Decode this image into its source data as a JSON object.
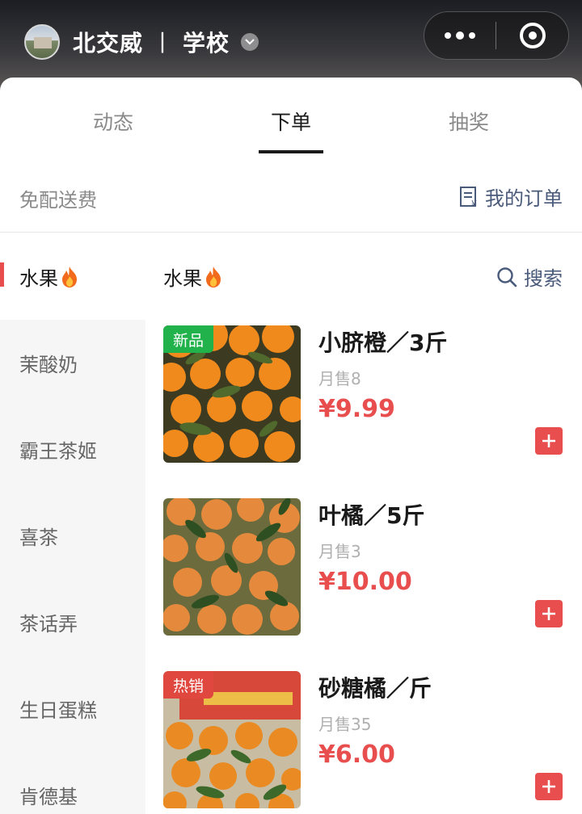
{
  "header": {
    "store_name": "北交威",
    "separator": "丨",
    "store_type": "学校"
  },
  "tabs": [
    {
      "label": "动态"
    },
    {
      "label": "下单"
    },
    {
      "label": "抽奖"
    }
  ],
  "active_tab": "下单",
  "subbar": {
    "notice": "免配送费",
    "orders_label": "我的订单"
  },
  "sidebar": {
    "items": [
      {
        "label": "水果",
        "active": true
      },
      {
        "label": "茉酸奶"
      },
      {
        "label": "霸王茶姬"
      },
      {
        "label": "喜茶"
      },
      {
        "label": "茶话弄"
      },
      {
        "label": "生日蛋糕"
      },
      {
        "label": "肯德基"
      }
    ]
  },
  "content": {
    "section_title": "水果",
    "search_label": "搜索",
    "products": [
      {
        "tag": "新品",
        "name": "小脐橙／3斤",
        "sold": "月售8",
        "price": "¥9.99"
      },
      {
        "tag": "",
        "name": "叶橘／5斤",
        "sold": "月售3",
        "price": "¥10.00"
      },
      {
        "tag": "热销",
        "name": "砂糖橘／斤",
        "sold": "月售35",
        "price": "¥6.00"
      }
    ]
  },
  "colors": {
    "accent_red": "#e94e4e",
    "tag_green": "#22b24c",
    "link_blue": "#4a5a7a"
  }
}
